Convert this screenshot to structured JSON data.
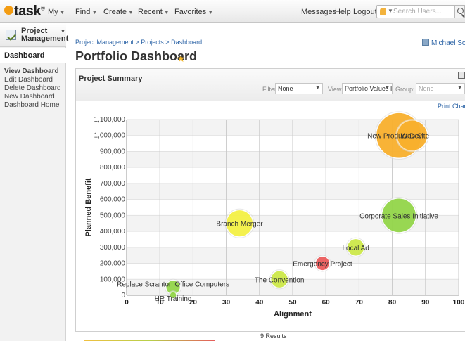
{
  "topbar": {
    "logo": "task",
    "logo_reg": "®",
    "menus": [
      {
        "label": "My"
      },
      {
        "label": "Find"
      },
      {
        "label": "Create"
      },
      {
        "label": "Recent"
      },
      {
        "label": "Favorites"
      }
    ],
    "links": {
      "messages": "Messages",
      "help": "Help",
      "logout": "Logout"
    },
    "search": {
      "placeholder": "Search Users..."
    }
  },
  "sidebar": {
    "section": "Project Management",
    "active": "Dashboard",
    "items": [
      {
        "label": "View Dashboard"
      },
      {
        "label": "Edit Dashboard"
      },
      {
        "label": "Delete Dashboard"
      },
      {
        "label": "New Dashboard"
      },
      {
        "label": "Dashboard Home"
      }
    ]
  },
  "main": {
    "breadcrumb": "Project Management > Projects > Dashboard",
    "user": "Michael Scott",
    "title": "Portfolio Dashboard",
    "panel": {
      "title": "Project Summary",
      "filter_label": "Filter:",
      "filter_value": "None",
      "view_label": "View:",
      "view_value": "Portfolio Values I",
      "group_label": "Group:",
      "group_value": "None",
      "print": "Print Chart"
    },
    "results": "9 Results"
  },
  "colors": {
    "orange": "#f7a81b",
    "yellow": "#f2ef36",
    "green": "#8ad23a",
    "lime": "#c8e63a",
    "red": "#e94e4e"
  },
  "chart_data": {
    "type": "scatter",
    "subtype": "bubble",
    "xlabel": "Alignment",
    "ylabel": "Planned Benefit",
    "xlim": [
      0,
      100
    ],
    "ylim": [
      0,
      1100000
    ],
    "xticks": [
      "0",
      "10",
      "20",
      "30",
      "40",
      "50",
      "60",
      "70",
      "80",
      "90",
      "100"
    ],
    "yticks": [
      "0",
      "100,000",
      "200,000",
      "300,000",
      "400,000",
      "500,000",
      "600,000",
      "700,000",
      "800,000",
      "900,000",
      "1,000,000",
      "1,100,000"
    ],
    "grid": true,
    "points": [
      {
        "label": "New Product Dev",
        "x": 82,
        "y": 1000000,
        "size": 60,
        "color": "#f7a81b"
      },
      {
        "label": "Web Site",
        "x": 86,
        "y": 1000000,
        "size": 40,
        "color": "#f7a81b"
      },
      {
        "label": "Corporate Sales Initiative",
        "x": 82,
        "y": 500000,
        "size": 45,
        "color": "#8ad23a"
      },
      {
        "label": "Branch Merger",
        "x": 34,
        "y": 450000,
        "size": 35,
        "color": "#f2ef36"
      },
      {
        "label": "Local Ad",
        "x": 69,
        "y": 300000,
        "size": 22,
        "color": "#c8e63a"
      },
      {
        "label": "Emergency Project",
        "x": 59,
        "y": 200000,
        "size": 18,
        "color": "#e94e4e"
      },
      {
        "label": "The Convention",
        "x": 46,
        "y": 100000,
        "size": 22,
        "color": "#c8e63a"
      },
      {
        "label": "Replace Scranton Office Computers",
        "x": 14,
        "y": 50000,
        "size": 18,
        "color": "#8ad23a"
      },
      {
        "label": "HR Training",
        "x": 14,
        "y": 0,
        "size": 8,
        "color": "#8ad23a"
      }
    ]
  }
}
